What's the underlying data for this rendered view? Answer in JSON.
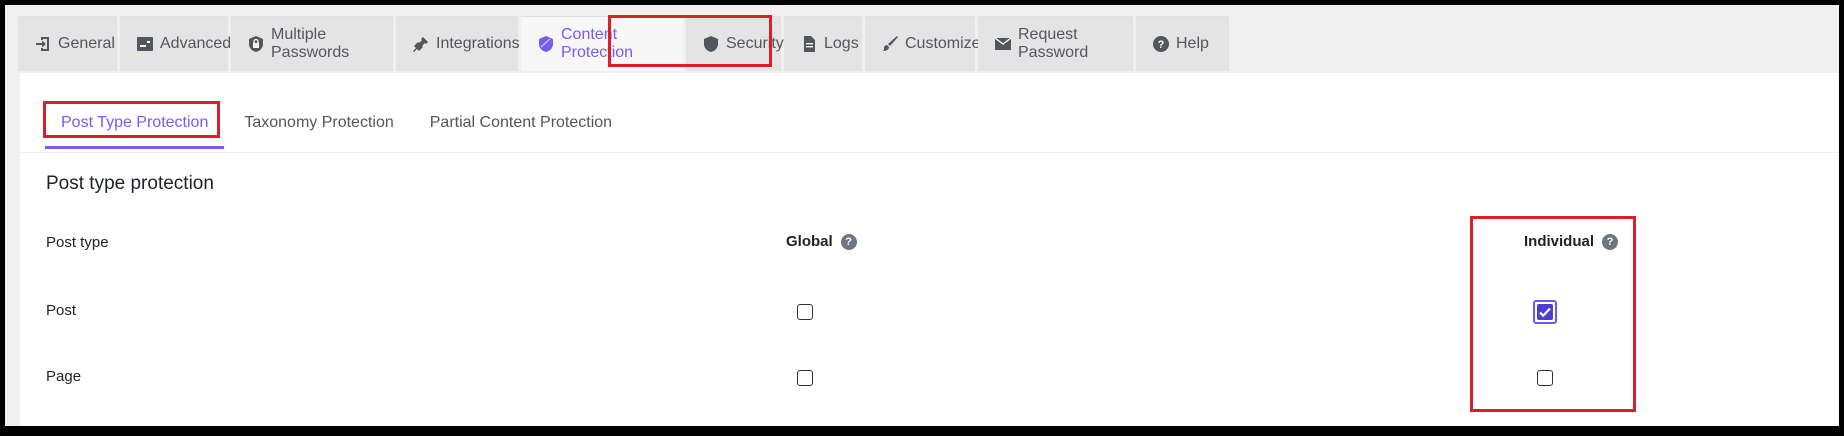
{
  "tabs": [
    {
      "label": "General",
      "icon": "sign-in-icon"
    },
    {
      "label": "Advanced",
      "icon": "advanced-icon"
    },
    {
      "label": "Multiple Passwords",
      "icon": "shield-lock-icon"
    },
    {
      "label": "Integrations",
      "icon": "plug-icon"
    },
    {
      "label": "Content Protection",
      "icon": "shield-icon",
      "active": true
    },
    {
      "label": "Security",
      "icon": "shield-icon"
    },
    {
      "label": "Logs",
      "icon": "document-icon"
    },
    {
      "label": "Customize",
      "icon": "brush-icon"
    },
    {
      "label": "Request Password",
      "icon": "envelope-icon"
    },
    {
      "label": "Help",
      "icon": "question-icon"
    }
  ],
  "subtabs": [
    {
      "label": "Post Type Protection",
      "active": true
    },
    {
      "label": "Taxonomy Protection"
    },
    {
      "label": "Partial Content Protection"
    }
  ],
  "section": {
    "title": "Post type protection",
    "col_post_type": "Post type",
    "col_global": "Global",
    "col_individual": "Individual",
    "help_glyph": "?",
    "rows": [
      {
        "label": "Post",
        "global": false,
        "individual": true
      },
      {
        "label": "Page",
        "global": false,
        "individual": false
      }
    ]
  },
  "colors": {
    "accent": "#7a5af0",
    "highlight": "#d9202a",
    "checked_fill": "#4c3fcf"
  }
}
